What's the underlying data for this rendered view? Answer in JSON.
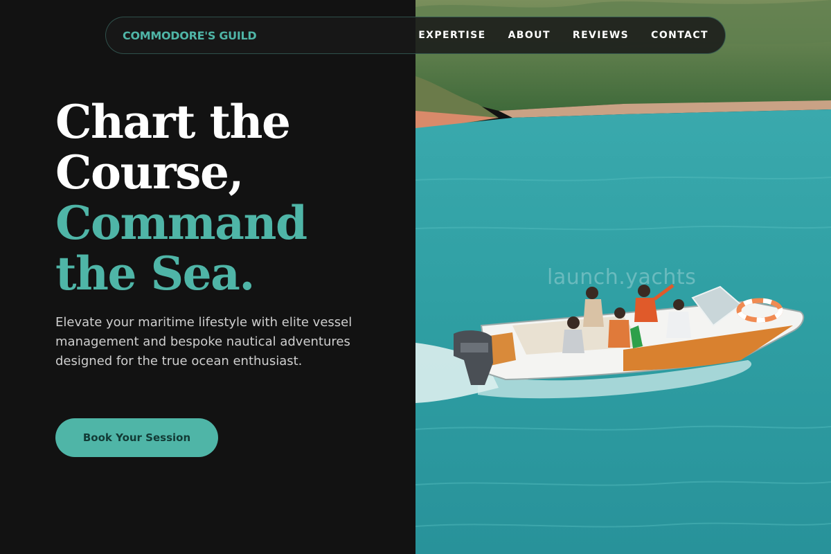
{
  "nav": {
    "brand": "COMMODORE'S GUILD",
    "links": [
      "EXPERTISE",
      "ABOUT",
      "REVIEWS",
      "CONTACT"
    ]
  },
  "hero": {
    "headline_lines": [
      "Chart the",
      "Course,",
      "Command",
      "the Sea."
    ],
    "description": "Elevate your maritime lifestyle with elite vessel management and bespoke nautical adventures designed for the true ocean enthusiast.",
    "cta_label": "Book Your Session"
  },
  "photo": {
    "watermark": "launch.yachts"
  },
  "colors": {
    "background": "#121212",
    "accent": "#4fb5a7",
    "text": "#ffffff",
    "muted_text": "#cfcfcf",
    "water": "#2f9ea2"
  }
}
